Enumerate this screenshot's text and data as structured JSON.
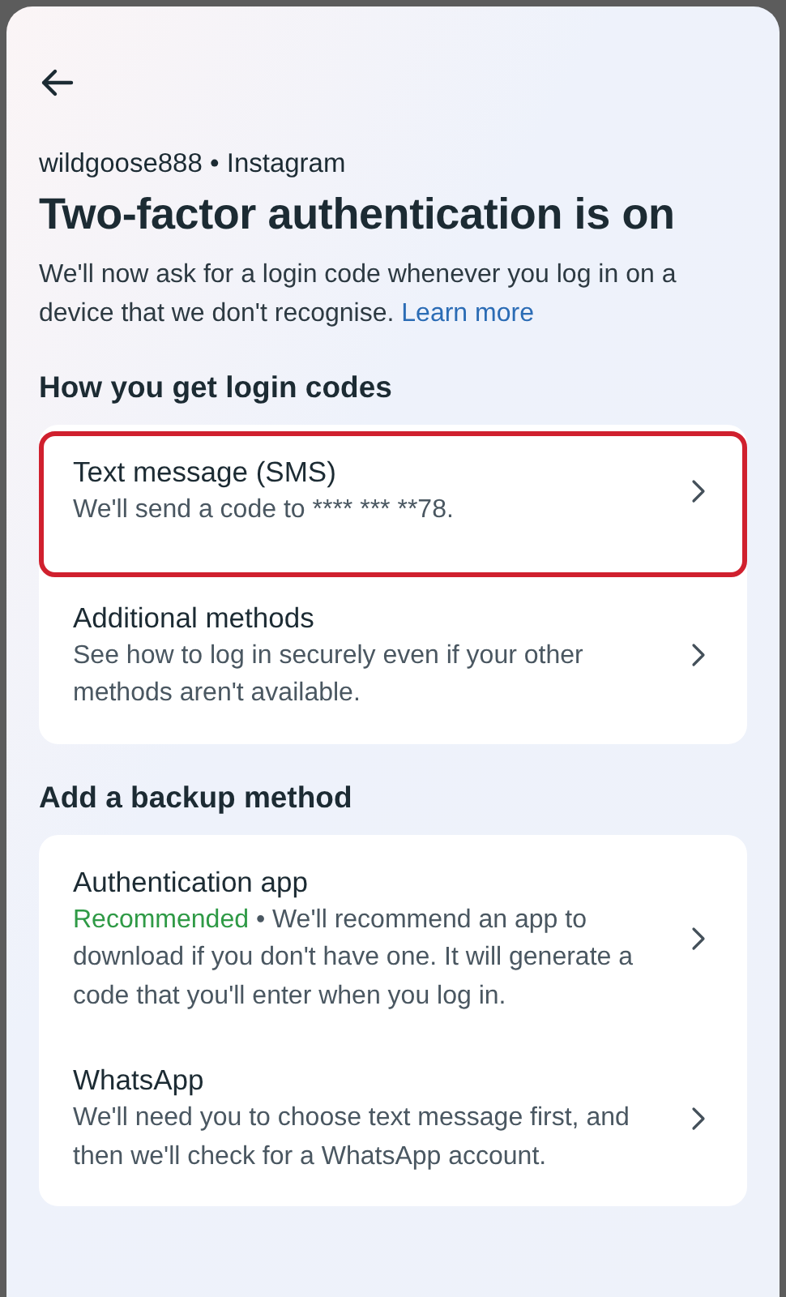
{
  "header": {
    "account": "wildgoose888 • Instagram",
    "title": "Two-factor authentication is on",
    "intro": "We'll now ask for a login code whenever you log in on a device that we don't recognise.",
    "learn_more": "Learn more"
  },
  "sections": [
    {
      "heading": "How you get login codes",
      "items": [
        {
          "title": "Text message (SMS)",
          "description": "We'll send a code to **** *** **78.",
          "highlighted": true
        },
        {
          "title": "Additional methods",
          "description": "See how to log in securely even if your other methods aren't available.",
          "highlighted": false
        }
      ]
    },
    {
      "heading": "Add a backup method",
      "items": [
        {
          "title": "Authentication app",
          "tag": "Recommended",
          "description": " • We'll recommend an app to download if you don't have one. It will generate a code that you'll enter when you log in.",
          "highlighted": false
        },
        {
          "title": "WhatsApp",
          "description": "We'll need you to choose text message first, and then we'll check for a WhatsApp account.",
          "highlighted": false
        }
      ]
    }
  ]
}
